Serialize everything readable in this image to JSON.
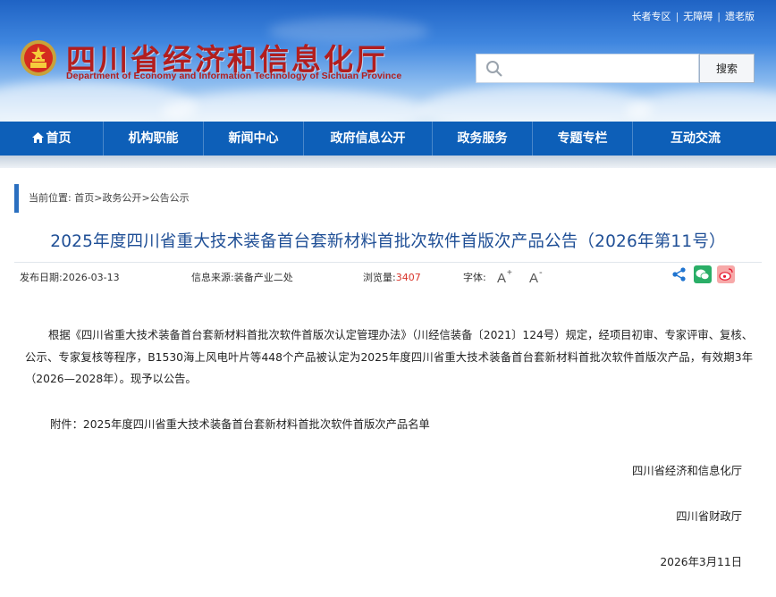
{
  "header": {
    "top_links": [
      "长者专区",
      "无障碍",
      "遗老版"
    ],
    "title_cn": "四川省经济和信息化厅",
    "title_en": "Department of Economy and Information Technology of Sichuan Province",
    "search_placeholder": "",
    "search_button": "搜索"
  },
  "nav": {
    "items": [
      "首页",
      "机构职能",
      "新闻中心",
      "政府信息公开",
      "政务服务",
      "专题专栏",
      "互动交流"
    ]
  },
  "breadcrumb": {
    "prefix": "当前位置:",
    "items": [
      "首页",
      "政务公开",
      "公告公示"
    ],
    "sep": ">"
  },
  "article": {
    "title": "2025年度四川省重大技术装备首台套新材料首批次软件首版次产品公告（2026年第11号）",
    "publish_label": "发布日期:",
    "publish_date": "2026-03-13",
    "source_label": "信息来源:",
    "source": "装备产业二处",
    "views_label": "浏览量:",
    "views": "3407",
    "font_label": "字体:",
    "body": "根据《四川省重大技术装备首台套新材料首批次软件首版次认定管理办法》（川经信装备〔2021〕124号）规定，经项目初审、专家评审、复核、公示、专家复核等程序，B1530海上风电叶片等448个产品被认定为2025年度四川省重大技术装备首台套新材料首批次软件首版次产品，有效期3年（2026—2028年）。现予以公告。",
    "attachment": "附件：2025年度四川省重大技术装备首台套新材料首批次软件首版次产品名单",
    "signers": [
      "四川省经济和信息化厅",
      "四川省财政厅"
    ],
    "sign_date": "2026年3月11日"
  },
  "colors": {
    "nav_bg": "#0d5fb8",
    "title": "#1f4f96",
    "brand_red": "#b21e1e",
    "views": "#d9352b",
    "wechat": "#2aae67",
    "weibo": "#e6162d"
  }
}
